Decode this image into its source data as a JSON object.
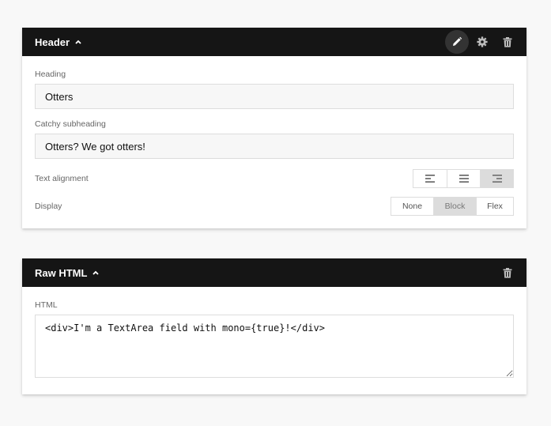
{
  "header_panel": {
    "title": "Header",
    "icons": [
      "pencil-icon",
      "gear-icon",
      "trash-icon"
    ],
    "heading": {
      "label": "Heading",
      "value": "Otters"
    },
    "subheading": {
      "label": "Catchy subheading",
      "value": "Otters? We got otters!"
    },
    "text_alignment": {
      "label": "Text alignment",
      "options": [
        "align-left",
        "align-center",
        "align-right"
      ],
      "selected": "align-right"
    },
    "display": {
      "label": "Display",
      "options": [
        "None",
        "Block",
        "Flex"
      ],
      "selected": "Block"
    }
  },
  "raw_html_panel": {
    "title": "Raw HTML",
    "icons": [
      "trash-icon"
    ],
    "html_field": {
      "label": "HTML",
      "value": "<div>I'm a TextArea field with mono={true}!</div>"
    }
  },
  "colors": {
    "page_background": "#f8f8f8",
    "header_bar": "#151515",
    "selected_segment": "#dcdcdc",
    "field_background": "#f7f7f7",
    "border": "#dddddd"
  }
}
